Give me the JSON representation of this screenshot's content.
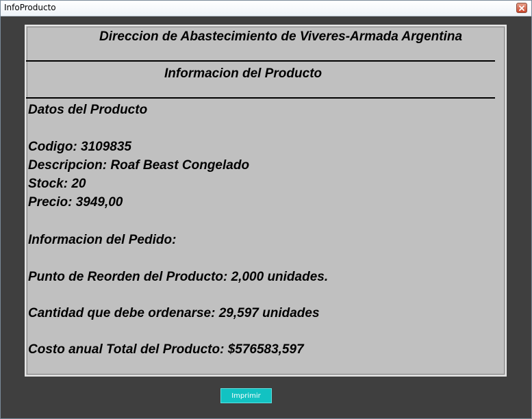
{
  "window": {
    "title": "InfoProducto"
  },
  "report": {
    "header": "Direccion de Abastecimiento de Viveres-Armada Argentina",
    "subheader": "Informacion del Producto",
    "section_product": "Datos del Producto",
    "codigo": "Codigo: 3109835",
    "descripcion": "Descripcion: Roaf Beast Congelado",
    "stock": "Stock: 20",
    "precio": "Precio: 3949,00",
    "section_order": "Informacion del Pedido:",
    "reorder_point": "Punto de Reorden del Producto: 2,000 unidades.",
    "order_quantity": "Cantidad que debe ordenarse: 29,597 unidades",
    "annual_cost": "Costo anual Total del Producto: $576583,597"
  },
  "actions": {
    "print_label": "Imprimir"
  },
  "colors": {
    "window_background": "#3f3f3f",
    "panel_background": "#c0c0c0",
    "print_button": "#12c2c2",
    "close_button": "#c9442a"
  },
  "icons": {
    "close": "close-icon"
  }
}
